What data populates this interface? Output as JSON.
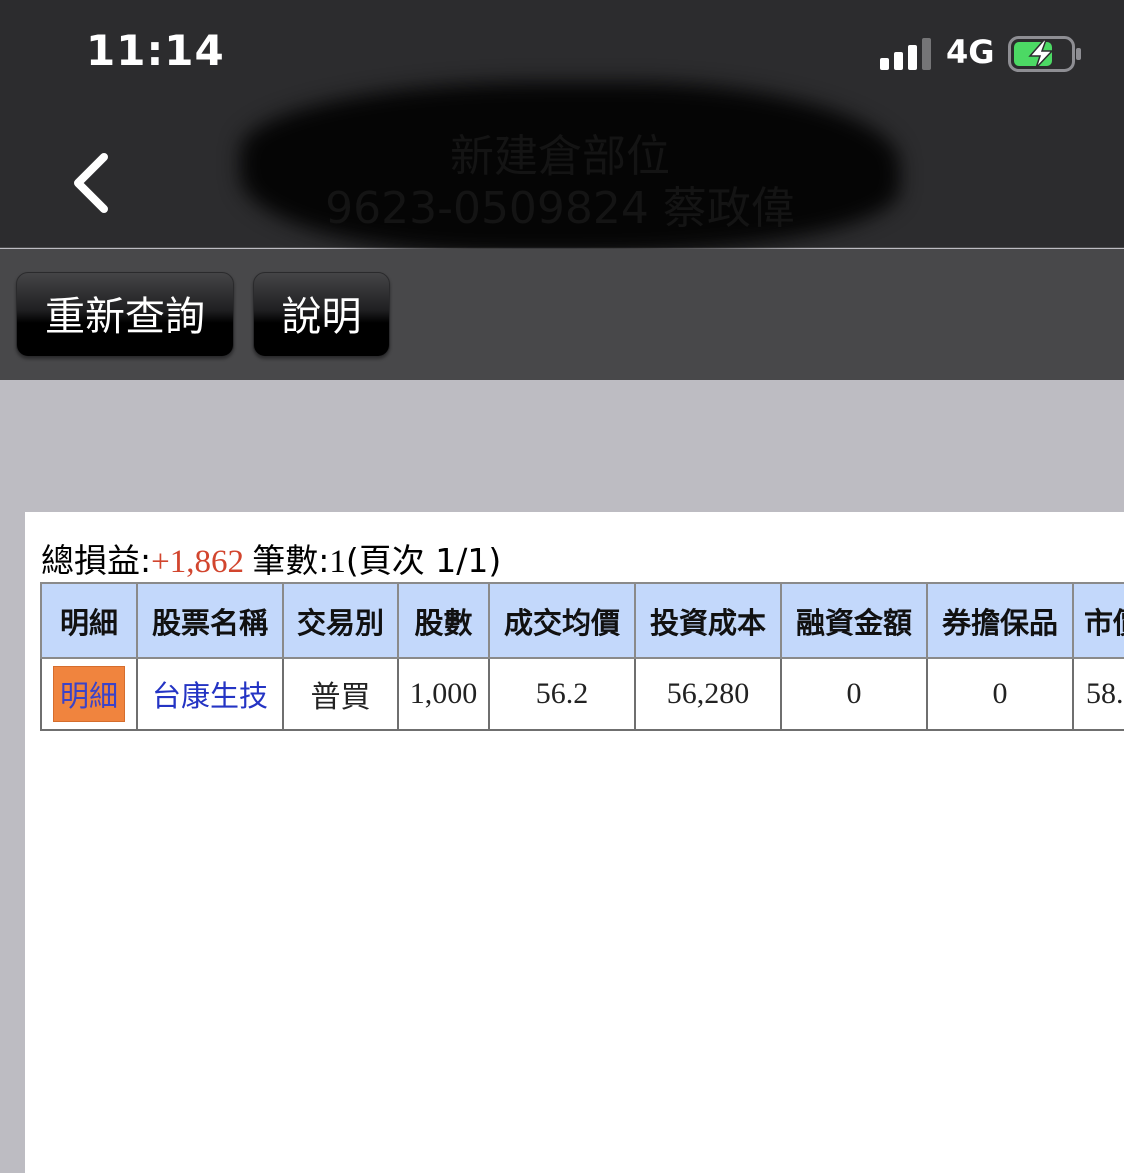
{
  "status_bar": {
    "time": "11:14",
    "network": "4G"
  },
  "header": {
    "title": "新建倉部位",
    "subtitle": "9623-0509824 蔡政偉"
  },
  "toolbar": {
    "requery_label": "重新查詢",
    "help_label": "說明"
  },
  "summary": {
    "total_pl_label": "總損益:",
    "total_pl_value": "+1,862",
    "count_label": "筆數:",
    "count_value": "1",
    "page_text": "(頁次 1/1)"
  },
  "table": {
    "headers": [
      "明細",
      "股票名稱",
      "交易別",
      "股數",
      "成交均價",
      "投資成本",
      "融資金額",
      "券擔保品",
      "市價"
    ],
    "rows": [
      [
        "明細",
        "台康生技",
        "普買",
        "1,000",
        "56.2",
        "56,280",
        "0",
        "0",
        "58."
      ]
    ]
  },
  "colors": {
    "header_bg": "#2c2c2e",
    "toolbar_bg": "#48484a",
    "table_header_bg": "#c3d8fb",
    "detail_button_bg": "#f0843e",
    "profit_red": "#d2452e",
    "link_blue": "#2434c4",
    "battery_green": "#4cd964"
  },
  "icons": {
    "back": "chevron-left-icon",
    "signal": "cellular-signal-icon",
    "battery": "battery-charging-icon"
  }
}
